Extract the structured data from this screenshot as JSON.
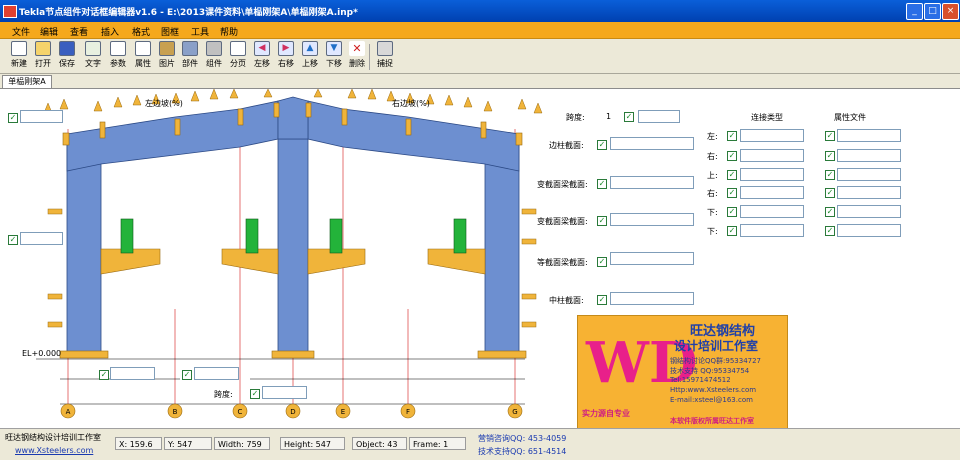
{
  "window": {
    "title": "Tekla节点组件对话框编辑器v1.6 - E:\\2013课件资料\\单榀刚架A\\单榀刚架A.inp*",
    "minimize": "_",
    "maximize": "□",
    "close": "×"
  },
  "menu": [
    "文件",
    "编辑",
    "查看",
    "插入",
    "格式",
    "图框",
    "工具",
    "帮助"
  ],
  "toolbar": [
    {
      "label": "新建",
      "icon": "new-file-icon"
    },
    {
      "label": "打开",
      "icon": "open-folder-icon"
    },
    {
      "label": "保存",
      "icon": "save-icon"
    },
    {
      "label": "文字",
      "icon": "text-icon"
    },
    {
      "label": "参数",
      "icon": "parameter-icon"
    },
    {
      "label": "属性",
      "icon": "attribute-icon"
    },
    {
      "label": "图片",
      "icon": "picture-icon"
    },
    {
      "label": "部件",
      "icon": "part-icon"
    },
    {
      "label": "组件",
      "icon": "component-icon"
    },
    {
      "label": "分页",
      "icon": "page-icon"
    },
    {
      "label": "左移",
      "icon": "arrow-left-icon"
    },
    {
      "label": "右移",
      "icon": "arrow-right-icon"
    },
    {
      "label": "上移",
      "icon": "arrow-up-icon"
    },
    {
      "label": "下移",
      "icon": "arrow-down-icon"
    },
    {
      "label": "删除",
      "icon": "delete-icon"
    },
    {
      "label": "捕捉",
      "icon": "snap-icon"
    }
  ],
  "tab": {
    "label": "单榀刚架A"
  },
  "drawing": {
    "left_slope": "左边坡(%)",
    "right_slope": "右边坡(%)",
    "elevation": "EL+0.000",
    "span_label": "跨度:",
    "axes": [
      "A",
      "B",
      "C",
      "D",
      "E",
      "F",
      "G"
    ]
  },
  "form": {
    "span_left": "跨度:",
    "span_left_num": "1",
    "left_col_section": "边柱截面:",
    "beam_section_1": "变截面梁截面:",
    "beam_section_2": "变截面梁截面:",
    "beam_section_3": "等截面梁截面:",
    "mid_col_section": "中柱截面:"
  },
  "table": {
    "col1_header": "连接类型",
    "col2_header": "属性文件",
    "rows": [
      "左:",
      "右:",
      "上:",
      "右:",
      "下:",
      "下:"
    ]
  },
  "logo": {
    "brand": "WD",
    "title1": "旺达钢结构",
    "title2": "设计培训工作室",
    "qq_group": "钢结构讨论QQ群:95334727",
    "tech_support": "技术支持 QQ:95334754",
    "tel": "Tel:15971474512",
    "website": "Http:www.Xsteelers.com",
    "email": "E-mail:xsteel@163.com",
    "slogan": "实力源自专业",
    "bottom": "本软件版权所属旺达工作室"
  },
  "status": {
    "company": "旺达钢结构设计培训工作室",
    "website": "www.Xsteelers.com",
    "x": "X: 159.6",
    "y": "Y: 547",
    "width": "Width: 759",
    "height": "Height: 547",
    "object": "Object: 43",
    "frame": "Frame: 1",
    "qq_group": "营销咨询QQ: 453-4059",
    "tech_qq": "技术支持QQ: 651-4514"
  },
  "colors": {
    "accent": "#f5a81c",
    "title": "#0a5fd9",
    "steel": "#6d8fd0",
    "plate": "#f0b43a"
  }
}
